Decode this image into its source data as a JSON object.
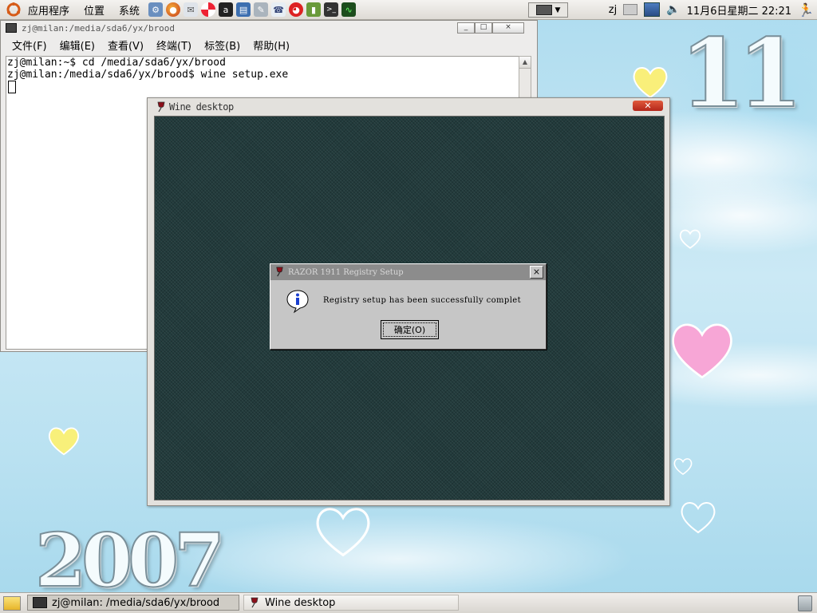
{
  "top_panel": {
    "menus": [
      "应用程序",
      "位置",
      "系统"
    ],
    "user": "zj",
    "clock": "11月6日星期二 22:21"
  },
  "wallpaper": {
    "day_number": "11",
    "year": "2007"
  },
  "terminal": {
    "title": "zj@milan:/media/sda6/yx/brood",
    "menu": [
      "文件(F)",
      "编辑(E)",
      "查看(V)",
      "终端(T)",
      "标签(B)",
      "帮助(H)"
    ],
    "lines": [
      "zj@milan:~$ cd /media/sda6/yx/brood",
      "zj@milan:/media/sda6/yx/brood$ wine setup.exe"
    ]
  },
  "wine_desktop": {
    "title": "Wine desktop"
  },
  "dialog": {
    "title": "RAZOR 1911 Registry Setup",
    "message": "Registry setup has been successfully complet",
    "ok_label": "确定(O)",
    "close_glyph": "×"
  },
  "taskbar": {
    "terminal_task": "zj@milan: /media/sda6/yx/brood",
    "wine_task": "Wine desktop"
  },
  "colors": {
    "wine_desktop_bg": "#223b3c",
    "dialog_bg": "#c6c6c6",
    "dialog_title_bg": "#8c8c8c"
  }
}
